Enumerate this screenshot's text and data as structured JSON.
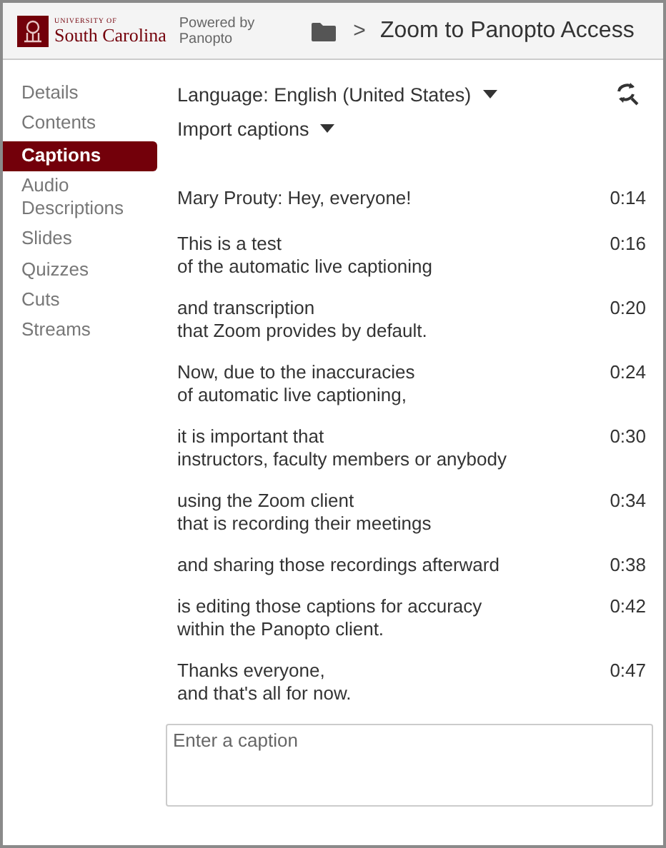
{
  "header": {
    "logo_top": "UNIVERSITY OF",
    "logo_name": "South Carolina",
    "powered_by": [
      "Powered by",
      "Panopto"
    ],
    "breadcrumb_separator": ">",
    "title": "Zoom to Panopto Access"
  },
  "sidebar": {
    "items": [
      {
        "label": "Details",
        "selected": false
      },
      {
        "label": "Contents",
        "selected": false
      },
      {
        "label": "Captions",
        "selected": true
      },
      {
        "label": "Audio Descriptions",
        "selected": false
      },
      {
        "label": "Slides",
        "selected": false
      },
      {
        "label": "Quizzes",
        "selected": false
      },
      {
        "label": "Cuts",
        "selected": false
      },
      {
        "label": "Streams",
        "selected": false
      }
    ]
  },
  "toolbar": {
    "language": "Language: English (United States)",
    "import": "Import captions"
  },
  "captions": [
    {
      "lines": [
        "Mary Prouty: Hey, everyone!"
      ],
      "time": "0:14"
    },
    {
      "lines": [
        "This is a test",
        "of the automatic live captioning"
      ],
      "time": "0:16"
    },
    {
      "lines": [
        "and transcription",
        "that Zoom provides by default."
      ],
      "time": "0:20"
    },
    {
      "lines": [
        "Now, due to the inaccuracies",
        "of automatic live captioning,"
      ],
      "time": "0:24"
    },
    {
      "lines": [
        "it is important that",
        "instructors, faculty members or anybody"
      ],
      "time": "0:30"
    },
    {
      "lines": [
        "using the Zoom client",
        "that is recording their meetings"
      ],
      "time": "0:34"
    },
    {
      "lines": [
        "and sharing those recordings afterward"
      ],
      "time": "0:38"
    },
    {
      "lines": [
        "is editing those captions for accuracy",
        "within the Panopto client."
      ],
      "time": "0:42"
    },
    {
      "lines": [
        "Thanks everyone,",
        "and that's all for now."
      ],
      "time": "0:47"
    }
  ],
  "caption_input": {
    "placeholder": "Enter a caption"
  }
}
